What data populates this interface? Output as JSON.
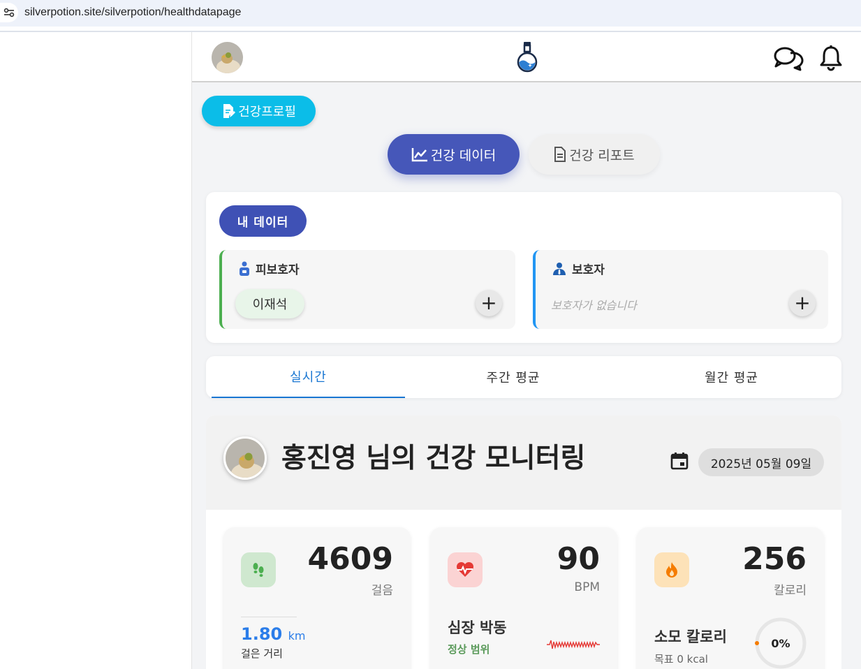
{
  "browser": {
    "url": "silverpotion.site/silverpotion/healthdatapage"
  },
  "header": {
    "logo": "flask-logo"
  },
  "profile_button": {
    "label": "건강프로필"
  },
  "view_tabs": [
    {
      "label": "건강 데이터",
      "active": true
    },
    {
      "label": "건강 리포트",
      "active": false
    }
  ],
  "my_data": {
    "label": "내 데이터",
    "dependent": {
      "title": "피보호자",
      "person": "이재석"
    },
    "guardian": {
      "title": "보호자",
      "empty": "보호자가 없습니다"
    },
    "add_symbol": "+"
  },
  "period_tabs": [
    {
      "label": "실시간",
      "active": true
    },
    {
      "label": "주간 평균",
      "active": false
    },
    {
      "label": "월간 평균",
      "active": false
    }
  ],
  "monitor": {
    "title": "홍진영 님의 건강 모니터링",
    "date": "2025년 05월 09일"
  },
  "metrics": {
    "steps": {
      "value": "4609",
      "unit": "걸음",
      "distance": "1.80",
      "distance_unit": "km",
      "distance_label": "걸은 거리"
    },
    "heart": {
      "value": "90",
      "unit": "BPM",
      "title": "심장 박동",
      "status": "정상 범위"
    },
    "calories": {
      "value": "256",
      "unit": "칼로리",
      "title": "소모 칼로리",
      "goal": "목표 0 kcal",
      "percent": "0%",
      "progress": 0
    }
  },
  "colors": {
    "accent_blue": "#4657b9",
    "cyan": "#0bbde8",
    "green": "#4caf50",
    "link_blue": "#1976d2",
    "heart_red": "#e53935",
    "fire_orange": "#f57c00"
  }
}
